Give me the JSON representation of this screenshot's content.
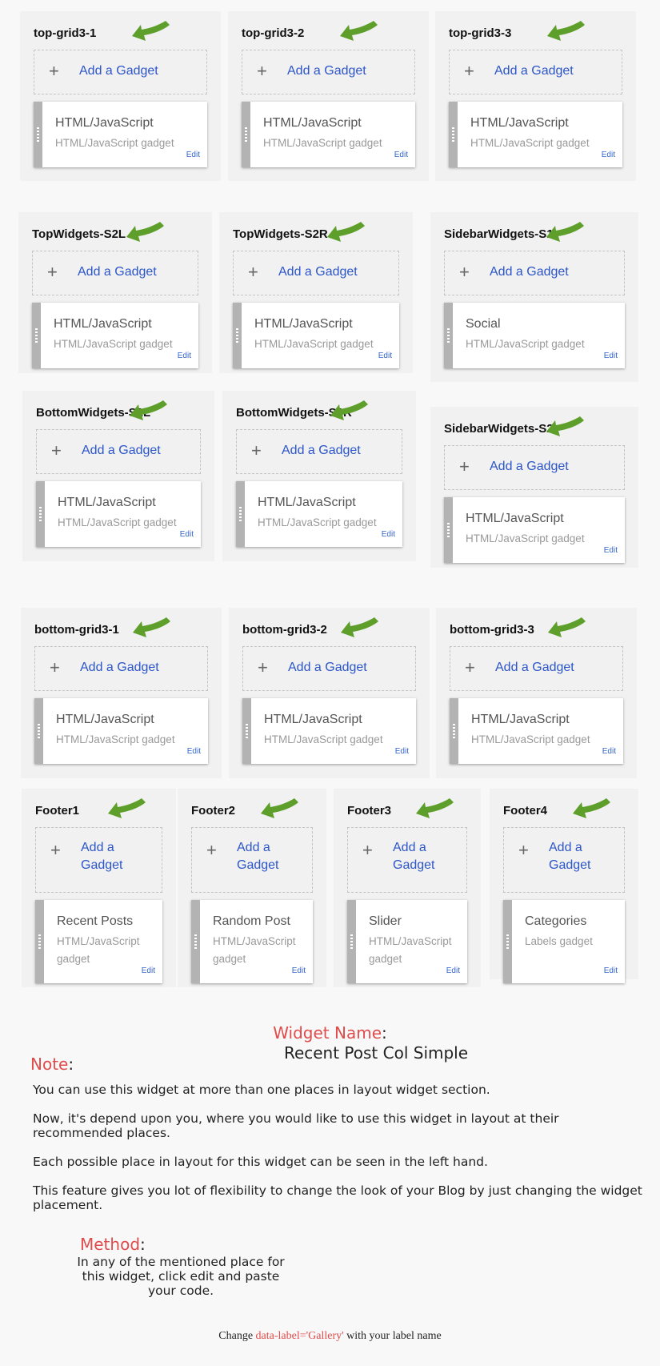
{
  "colors": {
    "accent": "#2c56c9",
    "red": "#e04b4b",
    "arrow": "#5e9f2b"
  },
  "add_label": "Add a Gadget",
  "edit_label": "Edit",
  "sections": [
    {
      "title": "top-grid3-1",
      "widget_title": "HTML/JavaScript",
      "widget_sub": "HTML/JavaScript gadget"
    },
    {
      "title": "top-grid3-2",
      "widget_title": "HTML/JavaScript",
      "widget_sub": "HTML/JavaScript gadget"
    },
    {
      "title": "top-grid3-3",
      "widget_title": "HTML/JavaScript",
      "widget_sub": "HTML/JavaScript gadget"
    },
    {
      "title": "TopWidgets-S2L",
      "widget_title": "HTML/JavaScript",
      "widget_sub": "HTML/JavaScript gadget"
    },
    {
      "title": "TopWidgets-S2R",
      "widget_title": "HTML/JavaScript",
      "widget_sub": "HTML/JavaScript gadget"
    },
    {
      "title": "SidebarWidgets-S1",
      "widget_title": "Social",
      "widget_sub": "HTML/JavaScript gadget"
    },
    {
      "title": "BottomWidgets-S2L",
      "widget_title": "HTML/JavaScript",
      "widget_sub": "HTML/JavaScript gadget"
    },
    {
      "title": "BottomWidgets-S2R",
      "widget_title": "HTML/JavaScript",
      "widget_sub": "HTML/JavaScript gadget"
    },
    {
      "title": "SidebarWidgets-S2",
      "widget_title": "HTML/JavaScript",
      "widget_sub": "HTML/JavaScript gadget"
    },
    {
      "title": "bottom-grid3-1",
      "widget_title": "HTML/JavaScript",
      "widget_sub": "HTML/JavaScript gadget"
    },
    {
      "title": "bottom-grid3-2",
      "widget_title": "HTML/JavaScript",
      "widget_sub": "HTML/JavaScript gadget"
    },
    {
      "title": "bottom-grid3-3",
      "widget_title": "HTML/JavaScript",
      "widget_sub": "HTML/JavaScript gadget"
    },
    {
      "title": "Footer1",
      "widget_title": "Recent Posts",
      "widget_sub": "HTML/JavaScript gadget"
    },
    {
      "title": "Footer2",
      "widget_title": "Random Post",
      "widget_sub": "HTML/JavaScript gadget"
    },
    {
      "title": "Footer3",
      "widget_title": "Slider",
      "widget_sub": "HTML/JavaScript gadget"
    },
    {
      "title": "Footer4",
      "widget_title": "Categories",
      "widget_sub": "Labels gadget"
    }
  ],
  "info": {
    "widget_name_label": "Widget Name",
    "widget_name": "Recent Post Col Simple",
    "note_label": "Note",
    "paragraphs": [
      "You can use this widget at more than one places in layout widget section.",
      "Now, it's depend upon you, where you would like to use this widget in layout at their recommended places.",
      "Each possible place in layout for this widget can be seen in the left hand.",
      "This feature gives you lot of flexibility to change the look of your Blog by just changing the widget placement."
    ],
    "method_label": "Method",
    "method_text": "In any of the mentioned place for this widget, click edit and paste your code.",
    "footer_prefix": "Change ",
    "footer_code": "data-label='Gallery'",
    "footer_suffix": " with your label name"
  }
}
